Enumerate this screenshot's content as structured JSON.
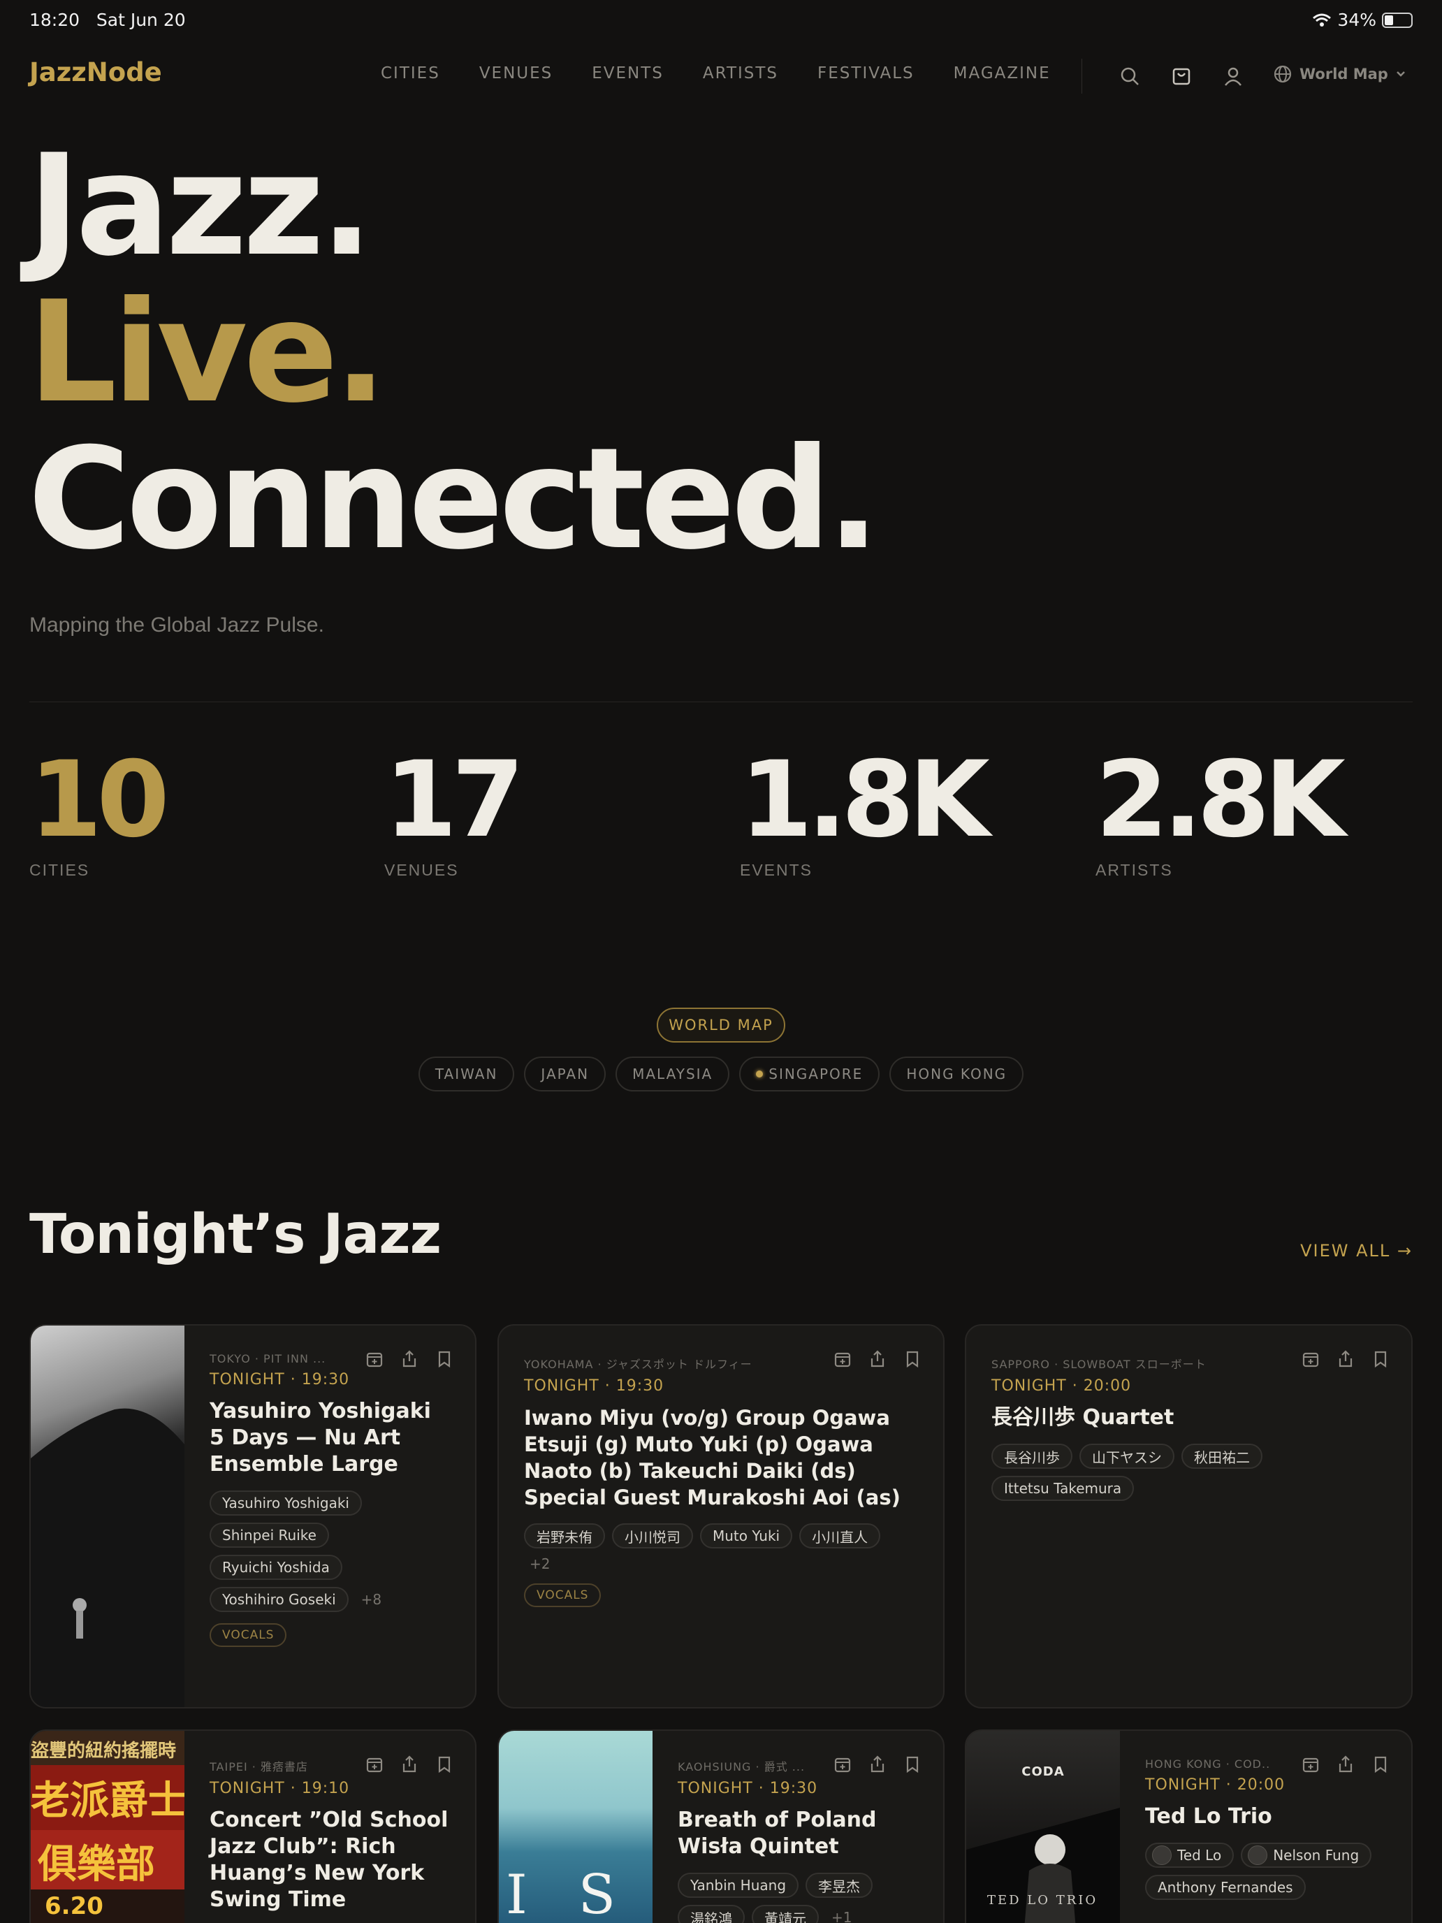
{
  "status": {
    "time": "18:20",
    "date": "Sat Jun 20",
    "battery": "34%",
    "battery_level": 0.34
  },
  "brand": {
    "logo": "JazzNode",
    "accent": "#c4a34f"
  },
  "nav": {
    "items": [
      "CITIES",
      "VENUES",
      "EVENTS",
      "ARTISTS",
      "FESTIVALS",
      "MAGAZINE"
    ],
    "icons": [
      "search-icon",
      "bag-icon",
      "user-icon"
    ],
    "world_label": "World Map"
  },
  "hero": {
    "line1": "Jazz.",
    "line2": "Live.",
    "line3": "Connected.",
    "tagline": "Mapping the Global Jazz Pulse."
  },
  "stats": [
    {
      "value": "10",
      "label": "CITIES",
      "color": "#b7994b"
    },
    {
      "value": "17",
      "label": "VENUES",
      "color": "#efece4"
    },
    {
      "value": "1.8K",
      "label": "EVENTS",
      "color": "#efece4"
    },
    {
      "value": "2.8K",
      "label": "ARTISTS",
      "color": "#efece4"
    }
  ],
  "worldmap": {
    "label": "WORLD MAP",
    "countries": [
      {
        "name": "TAIWAN",
        "active": false
      },
      {
        "name": "JAPAN",
        "active": false
      },
      {
        "name": "MALAYSIA",
        "active": false
      },
      {
        "name": "SINGAPORE",
        "active": true
      },
      {
        "name": "HONG KONG",
        "active": false
      }
    ]
  },
  "tonight": {
    "title": "Tonight’s Jazz",
    "view_all": "VIEW ALL →",
    "events": [
      {
        "meta": "TOKYO · PIT INN ...",
        "time": "TONIGHT · 19:30",
        "title": "Yasuhiro Yoshigaki 5 Days — Nu Art Ensemble Large",
        "artists": [
          "Yasuhiro Yoshigaki",
          "Shinpei Ruike",
          "Ryuichi Yoshida",
          "Yoshihiro Goseki"
        ],
        "more": "+8",
        "tag": "VOCALS"
      },
      {
        "meta": "YOKOHAMA · ジャズスポット ドルフィー",
        "time": "TONIGHT · 19:30",
        "title": "Iwano Miyu (vo/g) Group Ogawa Etsuji (g) Muto Yuki (p) Ogawa Naoto (b) Takeuchi Daiki (ds) Special Guest Murakoshi Aoi (as)",
        "artists": [
          "岩野未侑",
          "小川悦司",
          "Muto Yuki",
          "小川直人"
        ],
        "more": "+2",
        "tag": "VOCALS"
      },
      {
        "meta": "SAPPORO · SLOWBOAT スローボート",
        "time": "TONIGHT · 20:00",
        "title": "長谷川歩 Quartet",
        "artists": [
          "長谷川歩",
          "山下ヤスシ",
          "秋田祐二",
          "Ittetsu Takemura"
        ],
        "more": "",
        "tag": ""
      },
      {
        "meta": "TAIPEI · 雅痞書店",
        "time": "TONIGHT · 19:10",
        "title": "Concert ”Old School Jazz Club”: Rich Huang’s New York Swing Time",
        "artists": [],
        "more": "",
        "tag": "",
        "poster_text": [
          "盜豐的紐約搖擺時",
          "老派爵士",
          "俱樂部",
          "6.20"
        ]
      },
      {
        "meta": "KAOHSIUNG · 爵式 ...",
        "time": "TONIGHT · 19:30",
        "title": "Breath of Poland Wisła Quintet",
        "artists": [
          "Yanbin Huang",
          "李昱杰",
          "湯銘鴻",
          "黃靖元"
        ],
        "more": "+1",
        "tag": "",
        "poster_text": [
          "I S E"
        ]
      },
      {
        "meta": "HONG KONG · COD...",
        "time": "TONIGHT · 20:00",
        "title": "Ted Lo Trio",
        "artists": [
          "Ted Lo",
          "Nelson Fung",
          "Anthony Fernandes"
        ],
        "more": "",
        "tag": "",
        "poster_text": [
          "CODA",
          "TED LO TRIO"
        ]
      }
    ]
  }
}
